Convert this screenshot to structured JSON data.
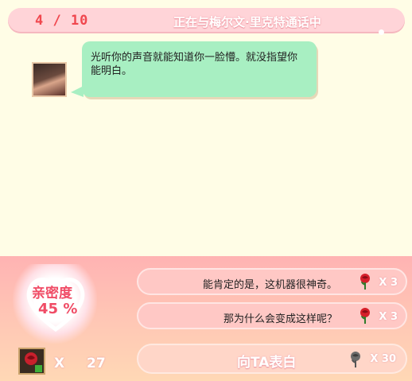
{
  "header": {
    "progress": "4 / 10",
    "call_status": "正在与梅尔文·里克特通话中"
  },
  "dialog": {
    "speaker_avatar": "character-portrait",
    "message": "光听你的声音就能知道你一脸懵。就没指望你能明白。"
  },
  "intimacy": {
    "label": "亲密度",
    "value": "45 %"
  },
  "choices": [
    {
      "text": "能肯定的是，这机器很神奇。",
      "cost_icon": "red-rose-icon",
      "cost": "X 3"
    },
    {
      "text": "那为什么会变成这样呢？",
      "cost_icon": "red-rose-icon",
      "cost": "X 3"
    }
  ],
  "inventory": {
    "item_icon": "rose-card-icon",
    "x_label": "X",
    "count": "27"
  },
  "confess": {
    "label": "向TA表白",
    "cost_icon": "gray-rose-icon",
    "cost": "X 30"
  },
  "colors": {
    "accent": "#f0474e",
    "bubble": "#a8efc2",
    "panel": "#ffb3b3",
    "background": "#fffde6"
  }
}
